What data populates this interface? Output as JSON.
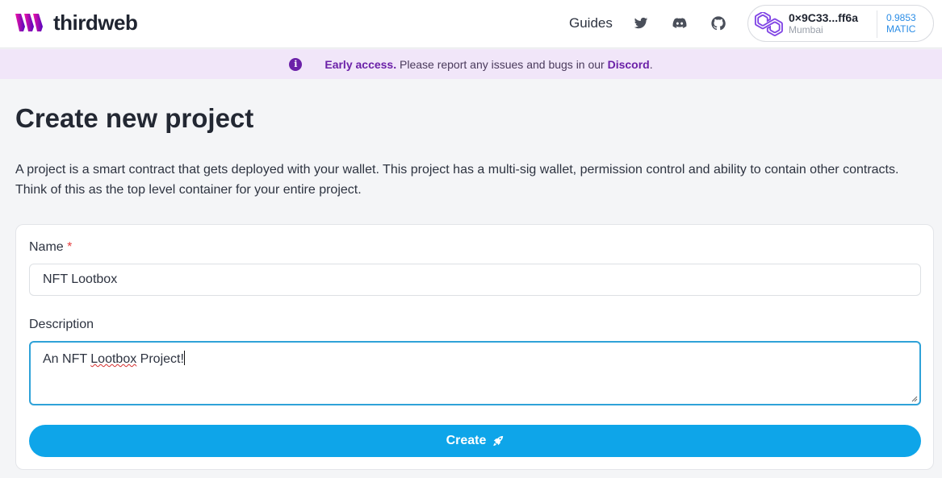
{
  "header": {
    "brand": "thirdweb",
    "nav_guides": "Guides",
    "wallet": {
      "address": "0×9C33...ff6a",
      "network": "Mumbai",
      "balance": "0.9853",
      "currency": "MATIC"
    }
  },
  "banner": {
    "bold": "Early access.",
    "text": " Please report any issues and bugs in our ",
    "link": "Discord",
    "tail": "."
  },
  "page": {
    "title": "Create new project",
    "description": "A project is a smart contract that gets deployed with your wallet. This project has a multi-sig wallet, permission control and ability to contain other contracts. Think of this as the top level container for your entire project."
  },
  "form": {
    "name_label": "Name",
    "required_mark": "*",
    "name_value": "NFT Lootbox",
    "description_label": "Description",
    "description_before": "An NFT ",
    "description_misspelled": "Lootbox",
    "description_after": " Project!",
    "create_label": "Create"
  },
  "colors": {
    "brand_purple": "#6b21a8",
    "accent_blue": "#0ea5e9",
    "banner_bg": "#f1e6f9"
  },
  "icons": [
    "thirdweb-logo-icon",
    "twitter-icon",
    "discord-icon",
    "github-icon",
    "polygon-icon",
    "info-icon",
    "rocket-icon"
  ]
}
